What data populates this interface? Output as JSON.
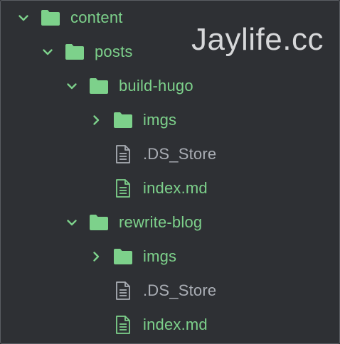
{
  "watermark": "Jaylife.cc",
  "colors": {
    "background": "#2e3034",
    "folder": "#7dd18b",
    "file_green": "#7dd18b",
    "file_grey": "#a9adb4"
  },
  "tree": [
    {
      "label": "content",
      "type": "folder",
      "expanded": true,
      "depth": 0
    },
    {
      "label": "posts",
      "type": "folder",
      "expanded": true,
      "depth": 1
    },
    {
      "label": "build-hugo",
      "type": "folder",
      "expanded": true,
      "depth": 2
    },
    {
      "label": "imgs",
      "type": "folder",
      "expanded": false,
      "depth": 3
    },
    {
      "label": ".DS_Store",
      "type": "file",
      "style": "grey",
      "depth": 3
    },
    {
      "label": "index.md",
      "type": "file",
      "style": "green",
      "depth": 3
    },
    {
      "label": "rewrite-blog",
      "type": "folder",
      "expanded": true,
      "depth": 2
    },
    {
      "label": "imgs",
      "type": "folder",
      "expanded": false,
      "depth": 3
    },
    {
      "label": ".DS_Store",
      "type": "file",
      "style": "grey",
      "depth": 3
    },
    {
      "label": "index.md",
      "type": "file",
      "style": "green",
      "depth": 3
    }
  ]
}
